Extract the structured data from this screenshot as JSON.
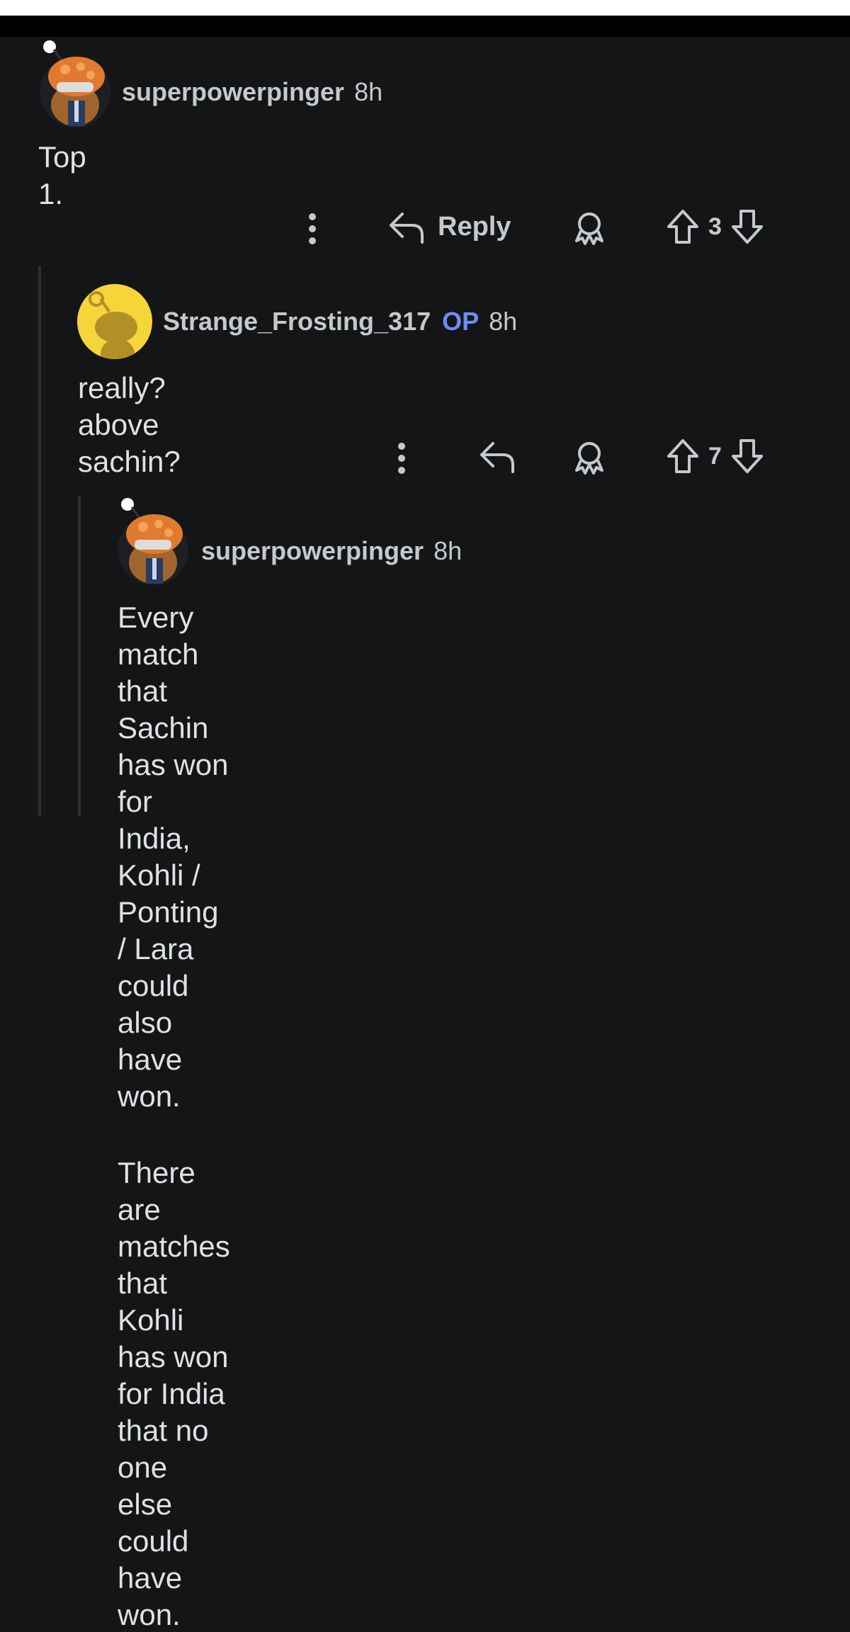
{
  "comments": [
    {
      "username": "superpowerpinger",
      "op": "",
      "time": "8h",
      "body": [
        "Top 1."
      ],
      "reply_label": "Reply",
      "score": "3"
    },
    {
      "username": "Strange_Frosting_317",
      "op": "OP",
      "time": "8h",
      "body": [
        "really? above sachin?"
      ],
      "reply_label": "",
      "score": "7"
    },
    {
      "username": "superpowerpinger",
      "op": "",
      "time": "8h",
      "body": [
        "Every match that Sachin has won for India,",
        "Kohli / Ponting / Lara could also have won.",
        "There are matches that Kohli has won for India",
        "that no one else could have won."
      ]
    }
  ],
  "icons": {
    "more": "more-options-icon",
    "reply": "reply-icon",
    "award": "award-icon",
    "upvote": "upvote-icon",
    "downvote": "downvote-icon",
    "avatar": "snoo-avatar"
  },
  "colors": {
    "background": "#141517",
    "op_badge": "#6e8cf5",
    "meta_text": "#c5c9cc",
    "body_text": "#dfe2e4",
    "thread_line": "#2c2e31"
  }
}
